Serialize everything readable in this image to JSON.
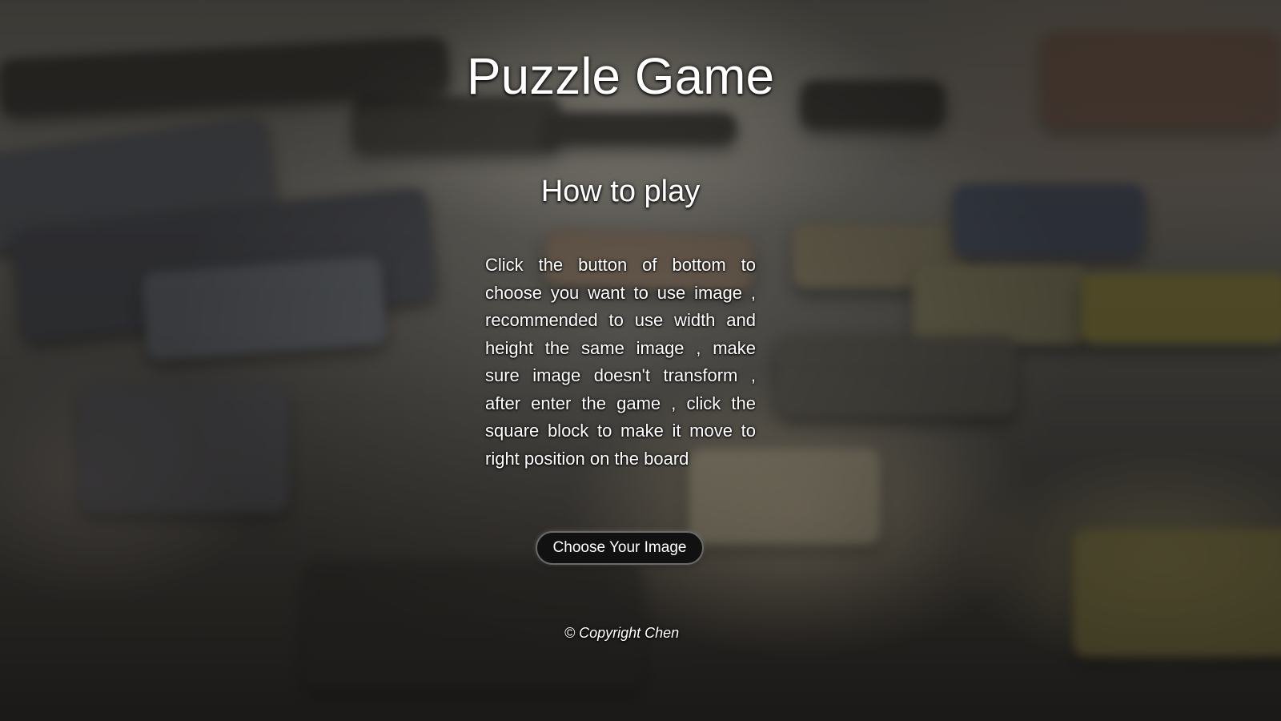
{
  "header": {
    "title": "Puzzle Game"
  },
  "howto": {
    "heading": "How to play",
    "text": "Click the button of bottom to choose you want to use image , recommended to use width and height the same image , make sure image doesn't transform , after enter the game , click the square block to make it move to right position on the board"
  },
  "actions": {
    "choose_image_label": "Choose Your Image"
  },
  "footer": {
    "copyright": "© Copyright Chen"
  },
  "colors": {
    "text": "#ffffff",
    "button_bg": "#111111",
    "button_border": "#6a6a6a"
  }
}
